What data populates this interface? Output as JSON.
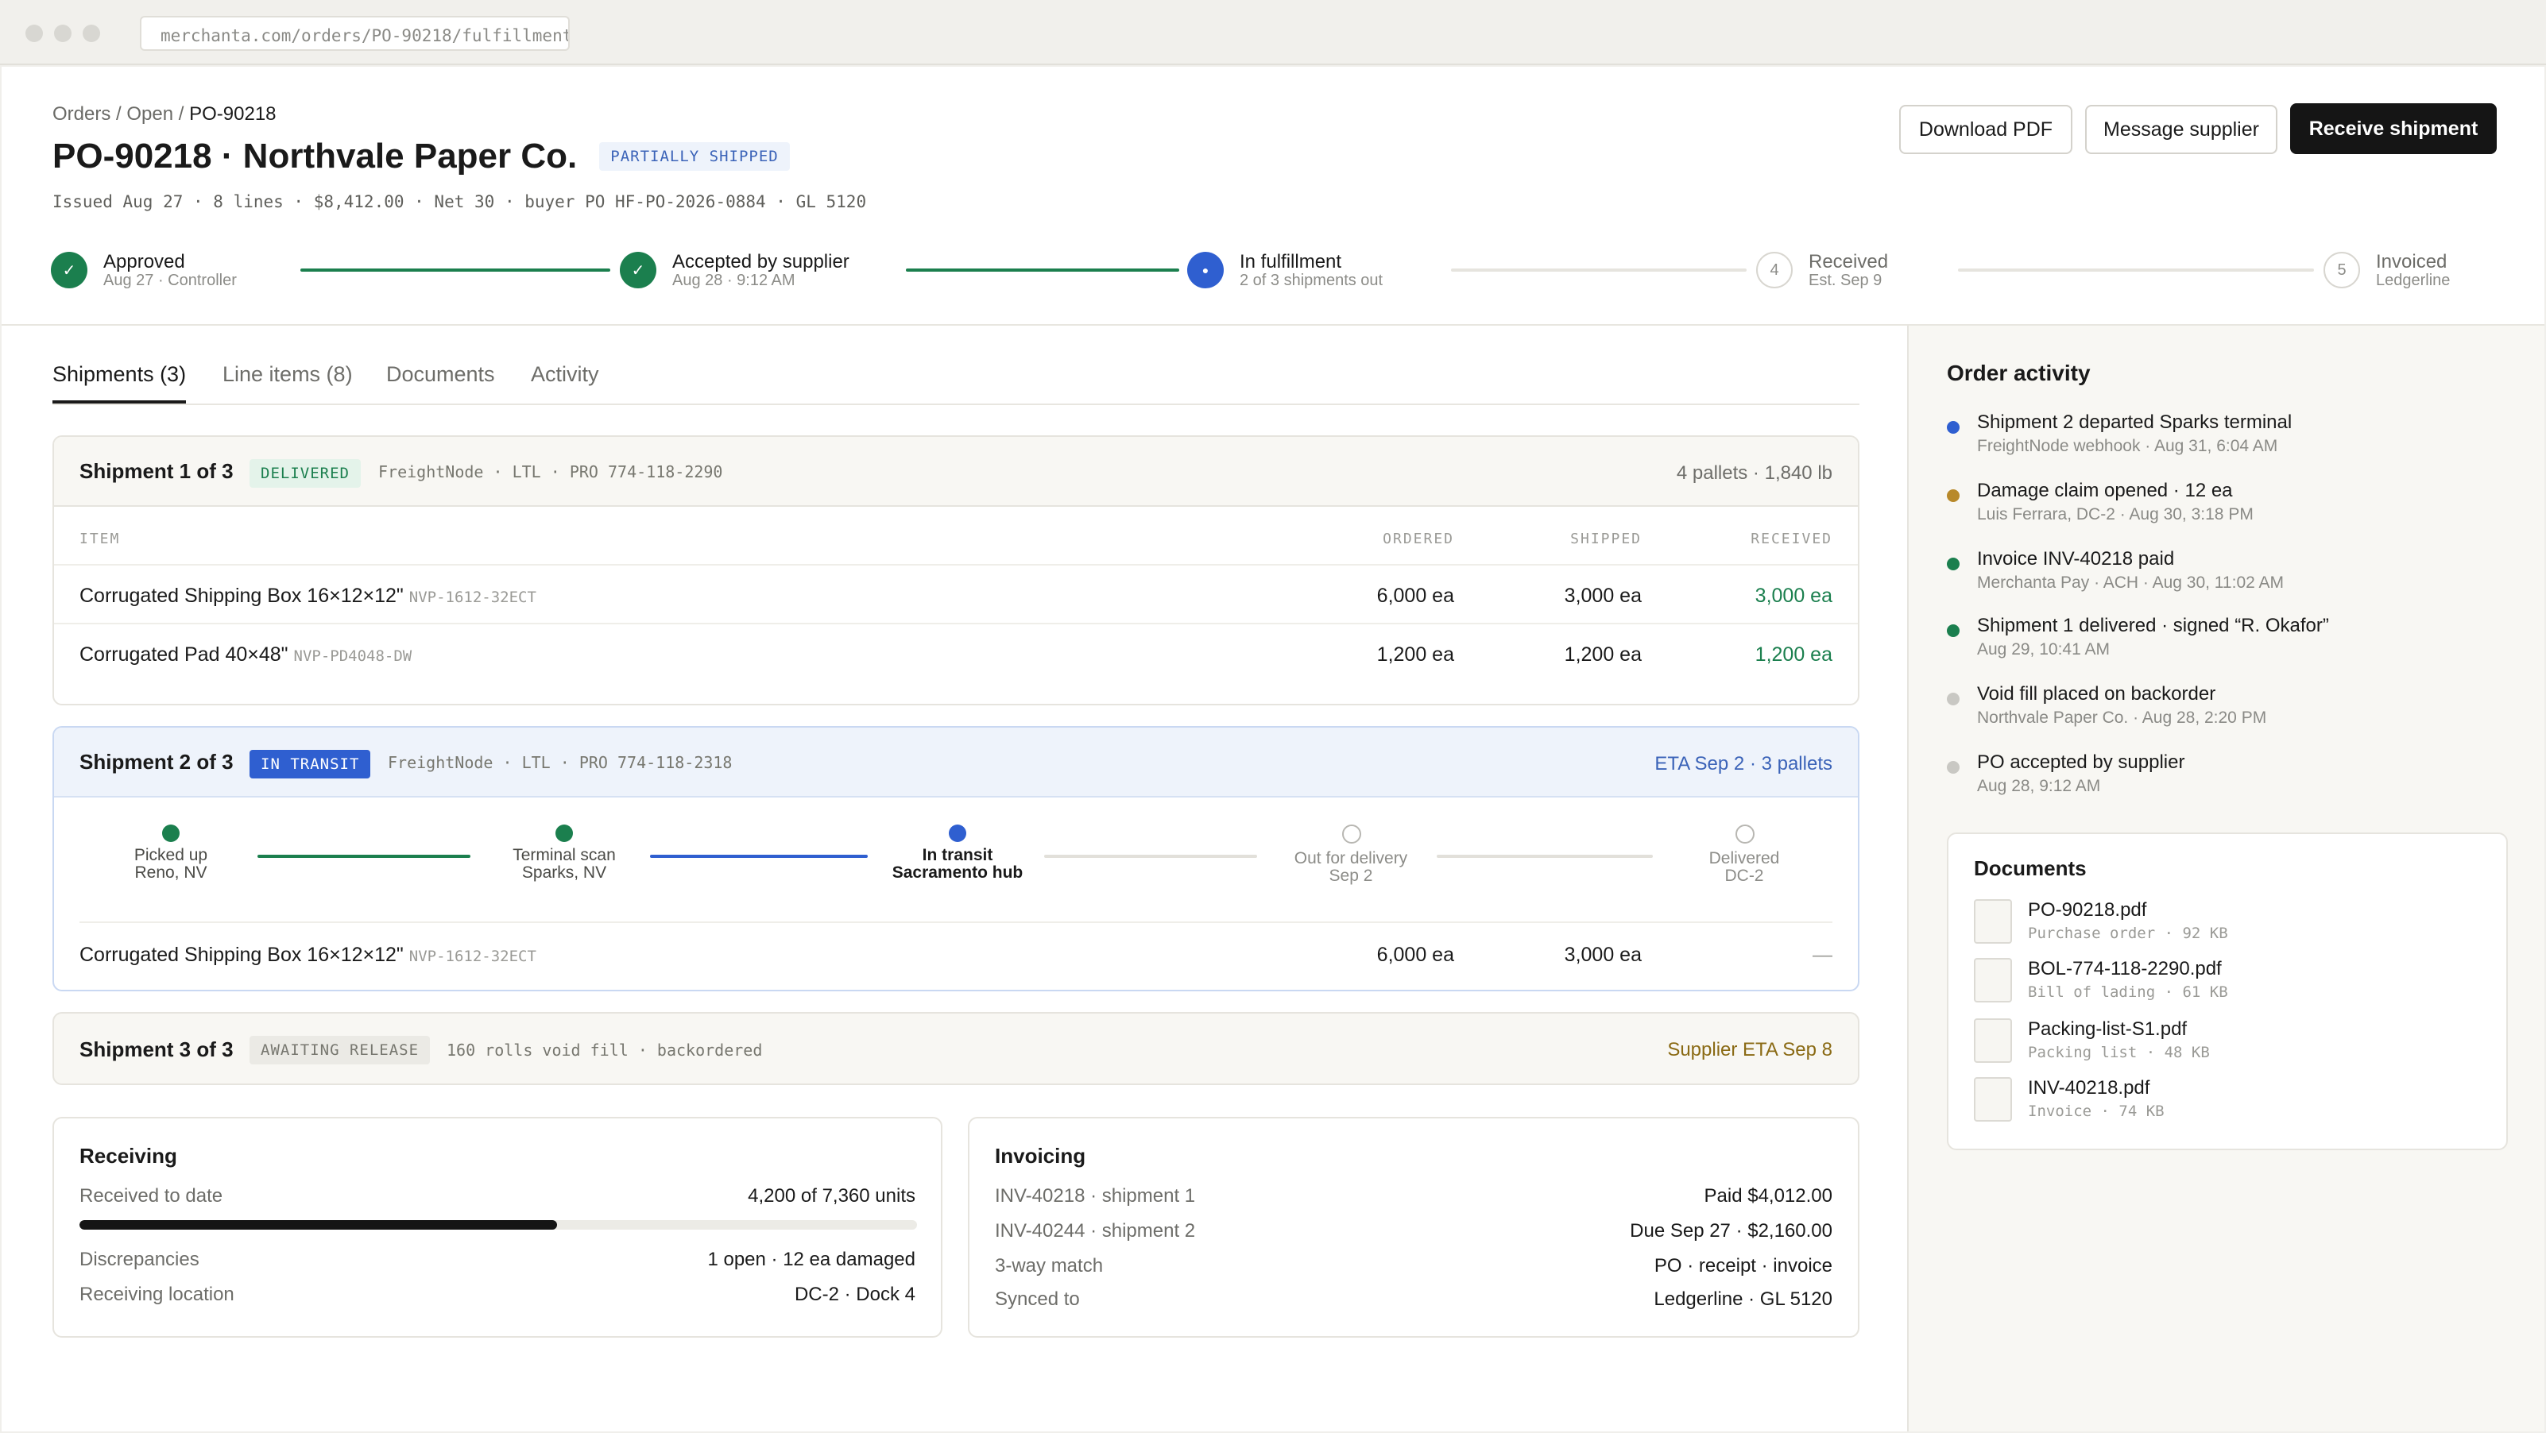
{
  "browser": {
    "url": "merchanta.com/orders/PO-90218/fulfillment"
  },
  "breadcrumb": {
    "orders": "Orders",
    "open": "Open",
    "current": "PO-90218",
    "sep": "/"
  },
  "header": {
    "title": "PO-90218 · Northvale Paper Co.",
    "status": "PARTIALLY SHIPPED",
    "meta": "Issued Aug 27 · 8 lines · $8,412.00 · Net 30 · buyer PO HF-PO-2026-0884 · GL 5120",
    "download": "Download PDF",
    "message": "Message supplier",
    "receive": "Receive shipment"
  },
  "steps": [
    {
      "title": "Approved",
      "sub": "Aug 27 · Controller",
      "glyph": "✓"
    },
    {
      "title": "Accepted by supplier",
      "sub": "Aug 28 · 9:12 AM",
      "glyph": "✓"
    },
    {
      "title": "In fulfillment",
      "sub": "2 of 3 shipments out",
      "glyph": "●"
    },
    {
      "title": "Received",
      "sub": "Est. Sep 9",
      "glyph": "4"
    },
    {
      "title": "Invoiced",
      "sub": "Ledgerline",
      "glyph": "5"
    }
  ],
  "tabs": [
    "Shipments (3)",
    "Line items (8)",
    "Documents",
    "Activity"
  ],
  "table_headers": {
    "item": "ITEM",
    "ordered": "ORDERED",
    "shipped": "SHIPPED",
    "received": "RECEIVED"
  },
  "shipment1": {
    "title": "Shipment 1 of 3",
    "status": "DELIVERED",
    "carrier": "FreightNode · LTL · PRO 774-118-2290",
    "summary": "4 pallets · 1,840 lb",
    "rows": [
      {
        "name": "Corrugated Shipping Box 16×12×12\"",
        "sku": "NVP-1612-32ECT",
        "ordered": "6,000 ea",
        "shipped": "3,000 ea",
        "received": "3,000 ea"
      },
      {
        "name": "Corrugated Pad 40×48\"",
        "sku": "NVP-PD4048-DW",
        "ordered": "1,200 ea",
        "shipped": "1,200 ea",
        "received": "1,200 ea"
      }
    ]
  },
  "shipment2": {
    "title": "Shipment 2 of 3",
    "status": "IN TRANSIT",
    "carrier": "FreightNode · LTL · PRO 774-118-2318",
    "summary": "ETA Sep 2 · 3 pallets",
    "tracking": [
      {
        "l1": "Picked up",
        "l2": "Reno, NV"
      },
      {
        "l1": "Terminal scan",
        "l2": "Sparks, NV"
      },
      {
        "l1": "In transit",
        "l2": "Sacramento hub"
      },
      {
        "l1": "Out for delivery",
        "l2": "Sep 2"
      },
      {
        "l1": "Delivered",
        "l2": "DC-2"
      }
    ],
    "row": {
      "name": "Corrugated Shipping Box 16×12×12\"",
      "sku": "NVP-1612-32ECT",
      "ordered": "6,000 ea",
      "shipped": "3,000 ea",
      "received": "—"
    }
  },
  "shipment3": {
    "title": "Shipment 3 of 3",
    "status": "AWAITING RELEASE",
    "note": "160 rolls void fill · backordered",
    "summary": "Supplier ETA Sep 8"
  },
  "receiving": {
    "title": "Receiving",
    "to_date_label": "Received to date",
    "to_date_value": "4,200 of 7,360 units",
    "progress": 0.57,
    "disc_label": "Discrepancies",
    "disc_value": "1 open · 12 ea damaged",
    "loc_label": "Receiving location",
    "loc_value": "DC-2 · Dock 4"
  },
  "invoicing": {
    "title": "Invoicing",
    "rows": [
      {
        "label": "INV-40218 · shipment 1",
        "value": "Paid $4,012.00"
      },
      {
        "label": "INV-40244 · shipment 2",
        "value": "Due Sep 27 · $2,160.00"
      },
      {
        "label": "3-way match",
        "value": "PO · receipt · invoice"
      },
      {
        "label": "Synced to",
        "value": "Ledgerline · GL 5120"
      }
    ]
  },
  "activity": {
    "title": "Order activity",
    "items": [
      {
        "title": "Shipment 2 departed Sparks terminal",
        "sub": "FreightNode webhook · Aug 31, 6:04 AM",
        "color": "#2f5fd0"
      },
      {
        "title": "Damage claim opened · 12 ea",
        "sub": "Luis Ferrara, DC-2 · Aug 30, 3:18 PM",
        "color": "#b8892a"
      },
      {
        "title": "Invoice INV-40218 paid",
        "sub": "Merchanta Pay · ACH · Aug 30, 11:02 AM",
        "color": "#1b7f4e"
      },
      {
        "title": "Shipment 1 delivered · signed “R. Okafor”",
        "sub": "Aug 29, 10:41 AM",
        "color": "#1b7f4e"
      },
      {
        "title": "Void fill placed on backorder",
        "sub": "Northvale Paper Co. · Aug 28, 2:20 PM",
        "color": "#c9c8c3"
      },
      {
        "title": "PO accepted by supplier",
        "sub": "Aug 28, 9:12 AM",
        "color": "#c9c8c3"
      }
    ]
  },
  "documents": {
    "title": "Documents",
    "items": [
      {
        "name": "PO-90218.pdf",
        "meta": "Purchase order · 92 KB"
      },
      {
        "name": "BOL-774-118-2290.pdf",
        "meta": "Bill of lading · 61 KB"
      },
      {
        "name": "Packing-list-S1.pdf",
        "meta": "Packing list · 48 KB"
      },
      {
        "name": "INV-40218.pdf",
        "meta": "Invoice · 74 KB"
      }
    ]
  }
}
